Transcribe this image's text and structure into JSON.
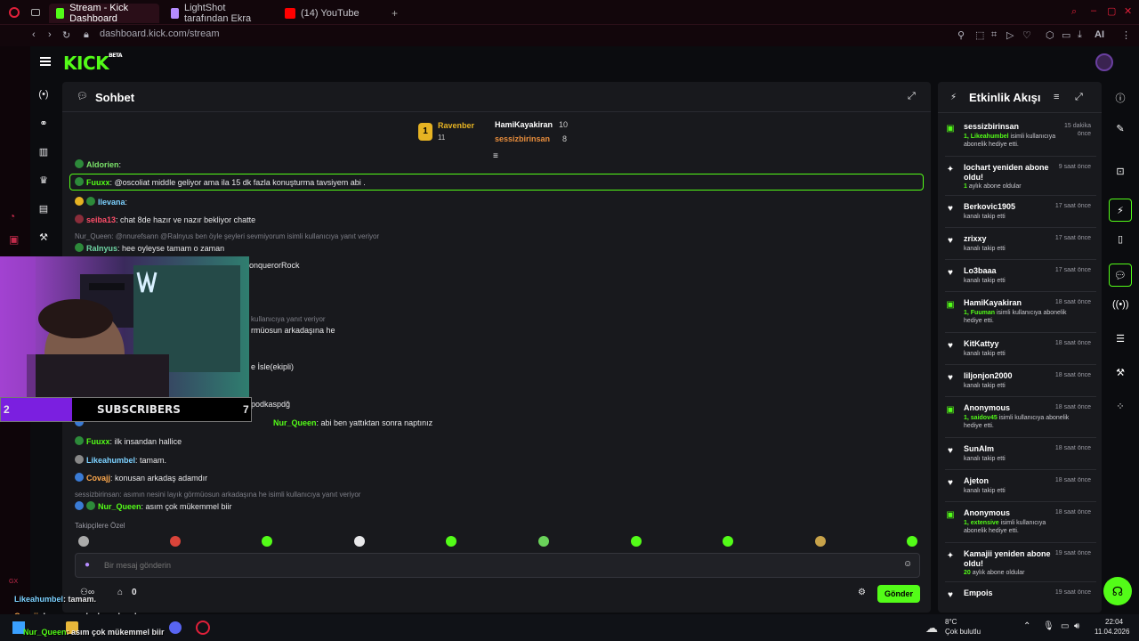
{
  "browser": {
    "tabs": [
      {
        "label": "Stream - Kick Dashboard",
        "active": true,
        "color": "#53fc18"
      },
      {
        "label": "LightShot tarafından Ekra",
        "active": false,
        "color": "#b68cff"
      },
      {
        "label": "(14) YouTube",
        "active": false,
        "color": "#ff0000"
      }
    ],
    "url": "dashboard.kick.com/stream",
    "ai_label": "AI"
  },
  "app": {
    "logo": "KICK",
    "logo_beta": "BETA"
  },
  "chat": {
    "title": "Sohbet",
    "leaders": [
      {
        "rank": "1",
        "name": "Ravenber",
        "count": "11"
      },
      {
        "name": "HamiKayakiran",
        "count": "10"
      },
      {
        "name": "sessizbirinsan",
        "count": "8"
      }
    ],
    "messages": [
      {
        "user": "Aldorien",
        "text": "",
        "color": "#7be36a"
      },
      {
        "user": "Fuuxx",
        "text": "@oscoliat middle geliyor ama ila 15 dk fazla konuşturma tavsiyem abi .",
        "color": "#53fc18",
        "highlight": true
      },
      {
        "user": "Ilevana",
        "text": "",
        "color": "#7cd1ff"
      },
      {
        "user": "seiba13",
        "text": "chat 8de hazır ve nazır bekliyor chatte",
        "color": "#ff4f6a"
      },
      {
        "reply": "Nur_Queen: @nnurefsann @Ralnyus ben öyle şeyleri sevmiyorum isimli kullanıcıya yanıt veriyor"
      },
      {
        "user": "Ralnyus",
        "text": "hee oyleyse tamam o zaman",
        "color": "#6fd6a4"
      },
      {
        "user": "",
        "text": "onquerorRock",
        "color": "#ffffff"
      },
      {
        "reply": "kullanıcıya yanıt veriyor"
      },
      {
        "user": "",
        "text": "rmüosun arkadaşına he",
        "color": "#ffffff"
      },
      {
        "user": "",
        "text": "e İsle(ekipli)",
        "color": "#ffffff"
      },
      {
        "user": "",
        "text": "podkaspdğ",
        "color": "#ffffff"
      },
      {
        "user": "Nur_Queen",
        "text": "abi ben yattıktan sonra naptınız",
        "color": "#53fc18"
      },
      {
        "user": "Fuuxx",
        "text": "ilk insandan hallice",
        "color": "#53fc18"
      },
      {
        "user": "Likeahumbel",
        "text": "tamam.",
        "color": "#7cd1ff"
      },
      {
        "user": "Covajj",
        "text": "konusan arkadaş adamdır",
        "color": "#ffa94d"
      },
      {
        "reply": "sessizbirinsan: asımın nesini layık görmüosun arkadaşına he isimli kullanıcıya yanıt veriyor"
      },
      {
        "user": "Nur_Queen",
        "text": "asım çok mükemmel biir",
        "color": "#53fc18"
      }
    ],
    "followers_label": "Takipçilere Özel",
    "input_placeholder": "Bir mesaj gönderin",
    "viewer_count": "0",
    "send_label": "Gönder"
  },
  "overlay": {
    "sub_left": "2",
    "sub_label": "SUBSCRIBERS",
    "sub_right": "7",
    "stream_chat": [
      {
        "user": "Likeahumbel",
        "text": ": tamam.",
        "color": "#7cd1ff"
      },
      {
        "user": "Covajj",
        "text": ": konusan arkadaş adamdır",
        "color": "#ffa94d"
      },
      {
        "user": "Nur_Queen",
        "text": ": asım çok mükemmel biir",
        "color": "#53fc18"
      }
    ]
  },
  "activity": {
    "title": "Etkinlik Akışı",
    "events": [
      {
        "name": "sessizbirinsan",
        "time": "15 dakika önce",
        "sub_pre": "1, Likeahumbel",
        "sub": " isimli kullanıcıya abonelik hediye etti.",
        "icon": "gift-icon"
      },
      {
        "name": "Iochart yeniden abone oldu!",
        "time": "9 saat önce",
        "sub_pre": "1",
        "sub": " aylık abone oldular",
        "icon": "sparkle-icon"
      },
      {
        "name": "Berkovic1905",
        "time": "17 saat önce",
        "sub_pre": "",
        "sub": "kanalı takip etti",
        "icon": "heart-icon"
      },
      {
        "name": "zrixxy",
        "time": "17 saat önce",
        "sub_pre": "",
        "sub": "kanalı takip etti",
        "icon": "heart-icon"
      },
      {
        "name": "Lo3baaa",
        "time": "17 saat önce",
        "sub_pre": "",
        "sub": "kanalı takip etti",
        "icon": "heart-icon"
      },
      {
        "name": "HamiKayakiran",
        "time": "18 saat önce",
        "sub_pre": "1, Fuuman",
        "sub": " isimli kullanıcıya abonelik hediye etti.",
        "icon": "gift-icon"
      },
      {
        "name": "KitKattyy",
        "time": "18 saat önce",
        "sub_pre": "",
        "sub": "kanalı takip etti",
        "icon": "heart-icon"
      },
      {
        "name": "liljonjon2000",
        "time": "18 saat önce",
        "sub_pre": "",
        "sub": "kanalı takip etti",
        "icon": "heart-icon"
      },
      {
        "name": "Anonymous",
        "time": "18 saat önce",
        "sub_pre": "1, saidov45",
        "sub": " isimli kullanıcıya abonelik hediye etti.",
        "icon": "gift-icon"
      },
      {
        "name": "SunAlm",
        "time": "18 saat önce",
        "sub_pre": "",
        "sub": "kanalı takip etti",
        "icon": "heart-icon"
      },
      {
        "name": "Ajeton",
        "time": "18 saat önce",
        "sub_pre": "",
        "sub": "kanalı takip etti",
        "icon": "heart-icon"
      },
      {
        "name": "Anonymous",
        "time": "18 saat önce",
        "sub_pre": "1, extensive",
        "sub": " isimli kullanıcıya abonelik hediye etti.",
        "icon": "gift-icon"
      },
      {
        "name": "Kamajii yeniden abone oldu!",
        "time": "19 saat önce",
        "sub_pre": "20",
        "sub": " aylık abone oldular",
        "icon": "sparkle-icon"
      },
      {
        "name": "Empois",
        "time": "19 saat önce",
        "sub_pre": "",
        "sub": "",
        "icon": "heart-icon"
      }
    ]
  },
  "taskbar": {
    "weather_temp": "8°C",
    "weather_desc": "Çok bulutlu",
    "time": "22:04",
    "date": "11.04.2026"
  }
}
